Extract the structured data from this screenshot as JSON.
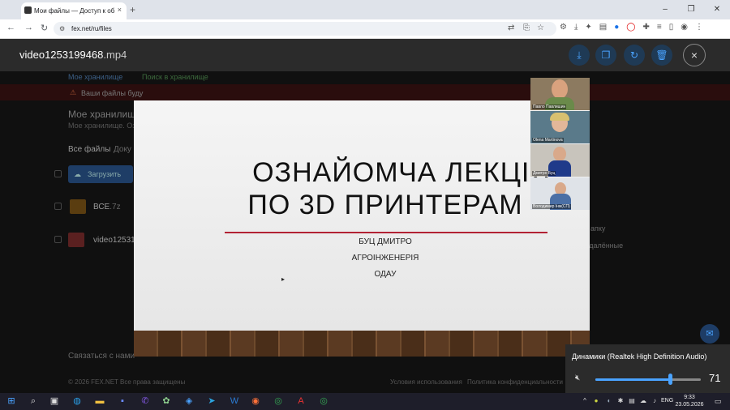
{
  "browser": {
    "tab_title": "Мои файлы — Доступ к об",
    "url": "fex.net/ru/files",
    "new_tab": "+",
    "tab_close": "×",
    "window_controls": [
      "–",
      "❐",
      "✕"
    ]
  },
  "viewer": {
    "filename_base": "video1253199468",
    "filename_ext": ".mp4",
    "actions": [
      "download-icon",
      "copy-icon",
      "sync-icon",
      "trash-icon"
    ],
    "close": "×"
  },
  "background_page": {
    "breadcrumb_1": "Мое хранилище",
    "breadcrumb_2": "Поиск в хранилище",
    "warning": "Ваши файлы буду",
    "title": "Мое хранилище",
    "subtitle": "Мое хранилище. Ози",
    "tab_all": "Все файлы",
    "tab_docs": "Доку",
    "upload": "Загрузить",
    "file1": "ВСЕ",
    "file1_ext": ".7z",
    "file2": "video12531",
    "side_folder": "апку",
    "side_deleted": "удалённые",
    "contact": "Связаться с нами",
    "copyright": "© 2026 FEX.NET Все права защищены",
    "terms": "Условия использования",
    "privacy": "Политика конфиденциальности"
  },
  "slide": {
    "title_line1": "ОЗНАЙОМЧА ЛЕКЦІЯ",
    "title_line2": "ПО 3D ПРИНТЕРАМ",
    "author": "БУЦ ДМИТРО",
    "department": "АГРОІНЖЕНЕРІЯ",
    "institution": "ОДАУ"
  },
  "participants": [
    {
      "name": "Павло Павлишин"
    },
    {
      "name": "Olena Martinova"
    },
    {
      "name": "Дмитро Буц"
    },
    {
      "name": "Володимир Інж(СП)"
    }
  ],
  "volume": {
    "device": "Динамики (Realtek High Definition Audio)",
    "level": 71,
    "mute_icon": "speaker-muted-icon"
  },
  "taskbar": {
    "lang": "ENG",
    "time": "9:33",
    "date": "23.05.2026"
  },
  "colors": {
    "accent": "#4aa3ff",
    "slide_line": "#b22234"
  }
}
